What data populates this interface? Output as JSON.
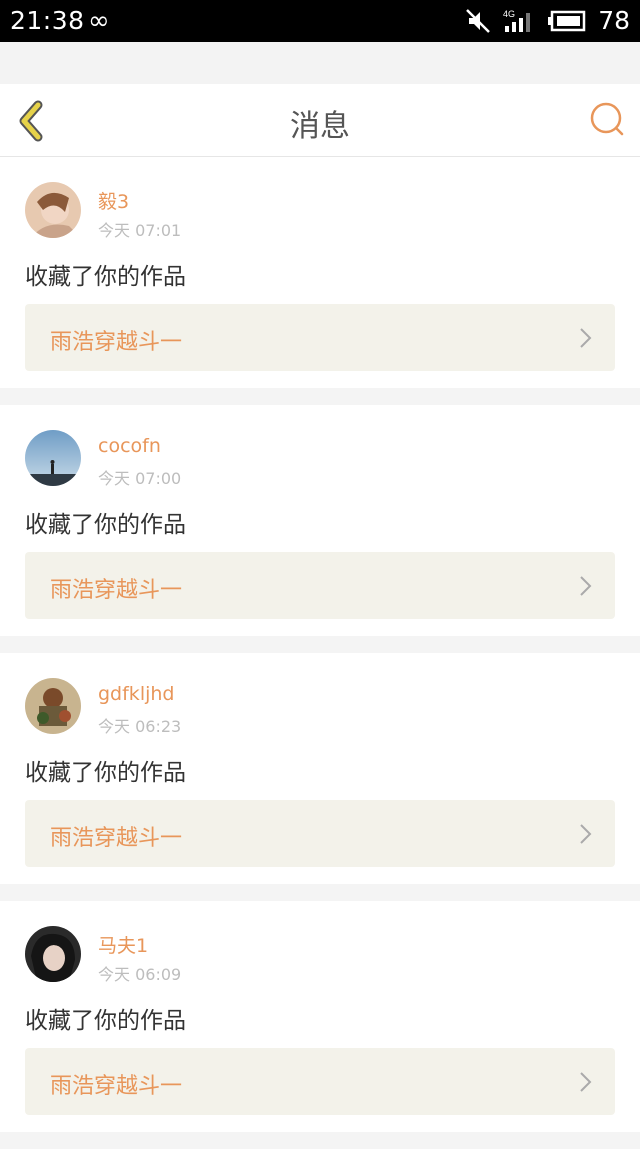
{
  "status_bar": {
    "time": "21:38",
    "infinity_icon": "∞",
    "battery": "78",
    "icons": [
      "mute-icon",
      "signal-4g-icon",
      "battery-icon"
    ]
  },
  "header": {
    "title": "消息",
    "back_icon": "chevron-left-icon",
    "search_icon": "search-icon"
  },
  "messages": [
    {
      "user": "毅3",
      "time": "今天 07:01",
      "action": "收藏了你的作品",
      "work": "雨浩穿越斗一"
    },
    {
      "user": "cocofn",
      "time": "今天 07:00",
      "action": "收藏了你的作品",
      "work": "雨浩穿越斗一"
    },
    {
      "user": "gdfkljhd",
      "time": "今天 06:23",
      "action": "收藏了你的作品",
      "work": "雨浩穿越斗一"
    },
    {
      "user": "马夫1",
      "time": "今天 06:09",
      "action": "收藏了你的作品",
      "work": "雨浩穿越斗一"
    }
  ],
  "colors": {
    "accent": "#e8965a",
    "back_icon": "#e6d24a",
    "work_bg": "#f3f2ea"
  }
}
